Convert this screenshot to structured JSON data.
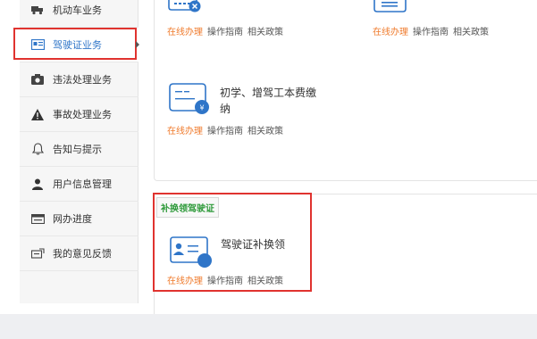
{
  "sidebar": {
    "items": [
      {
        "label": "机动车业务",
        "icon": "truck-icon"
      },
      {
        "label": "驾驶证业务",
        "icon": "license-card-icon"
      },
      {
        "label": "违法处理业务",
        "icon": "camera-icon"
      },
      {
        "label": "事故处理业务",
        "icon": "warning-icon"
      },
      {
        "label": "告知与提示",
        "icon": "bell-icon"
      },
      {
        "label": "用户信息管理",
        "icon": "user-icon"
      },
      {
        "label": "网办进度",
        "icon": "progress-icon"
      },
      {
        "label": "我的意见反馈",
        "icon": "feedback-icon"
      }
    ]
  },
  "services": {
    "row1_left_links": {
      "primary": "在线办理",
      "guide": "操作指南",
      "policy": "相关政策"
    },
    "row1_right_links": {
      "primary": "在线办理",
      "guide": "操作指南",
      "policy": "相关政策"
    },
    "fee": {
      "title_line1": "初学、增驾工本费缴",
      "title_line2": "纳",
      "primary": "在线办理",
      "guide": "操作指南",
      "policy": "相关政策"
    },
    "replace": {
      "tag": "补换领驾驶证",
      "title": "驾驶证补换领",
      "primary": "在线办理",
      "guide": "操作指南",
      "policy": "相关政策"
    }
  },
  "colors": {
    "accent": "#2f75c8",
    "link_orange": "#ef7a2b",
    "highlight_red": "#e0332f",
    "tag_green": "#2e9a3a"
  }
}
